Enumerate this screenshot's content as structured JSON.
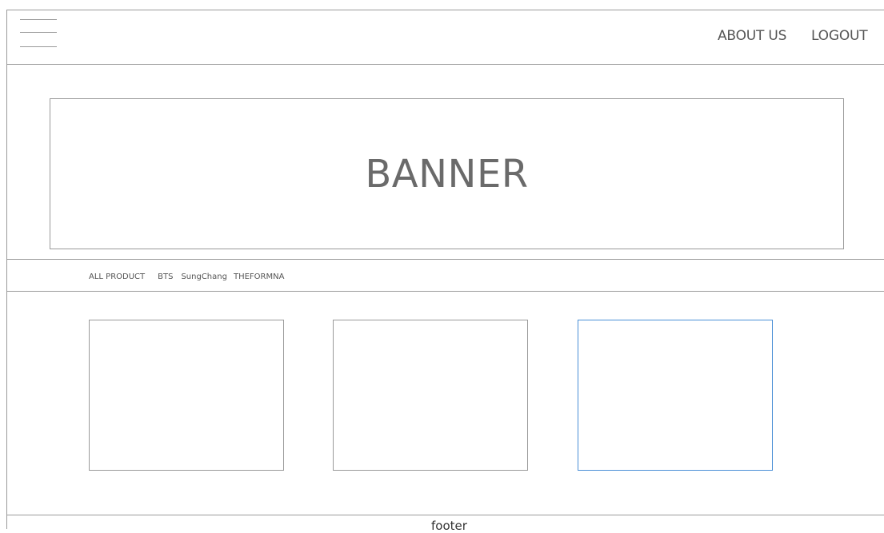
{
  "header": {
    "menu_icon": "hamburger-menu-icon",
    "about_label": "ABOUT US",
    "logout_label": "LOGOUT"
  },
  "banner": {
    "label": "BANNER"
  },
  "categories": [
    {
      "label": "ALL PRODUCT"
    },
    {
      "label": "BTS"
    },
    {
      "label": "SungChang"
    },
    {
      "label": "THEFORMNA"
    }
  ],
  "products": [
    {
      "label": ""
    },
    {
      "label": ""
    },
    {
      "label": "",
      "state": "selected"
    }
  ],
  "footer": {
    "label": "footer"
  },
  "colors": {
    "border": "#9a9a9a",
    "selected_border": "#4a8fd6",
    "text": "#555555"
  }
}
